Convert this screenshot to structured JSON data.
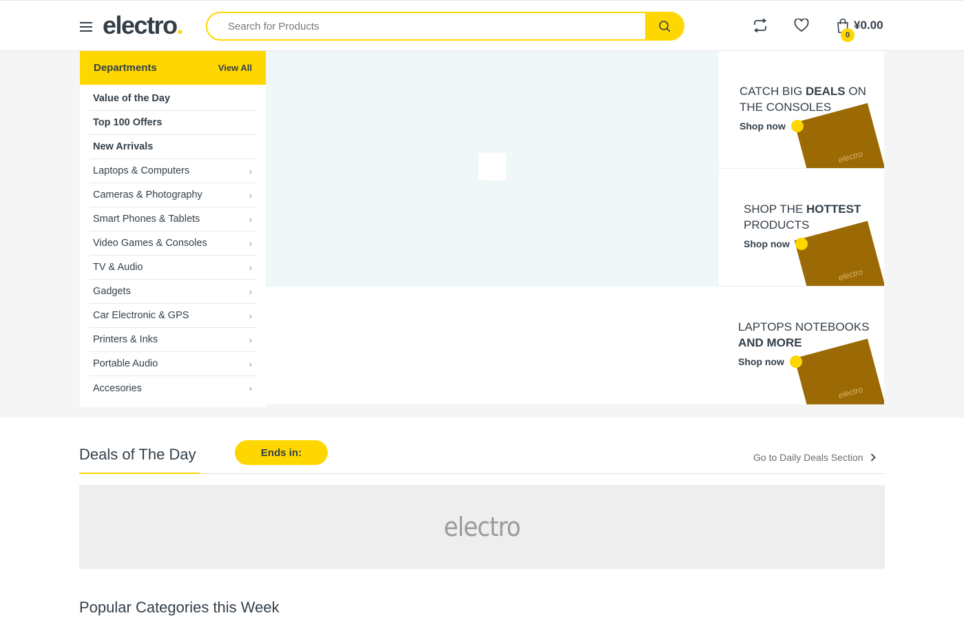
{
  "header": {
    "logo_text": "electro",
    "logo_dot": ".",
    "search_placeholder": "Search for Products",
    "cart_count": "0",
    "cart_total": "¥0.00",
    "accent_color": "#fed700"
  },
  "departments": {
    "title": "Departments",
    "view_all": "View All",
    "items": [
      {
        "label": "Value of the Day",
        "bold": true
      },
      {
        "label": "Top 100 Offers",
        "bold": true
      },
      {
        "label": "New Arrivals",
        "bold": true
      },
      {
        "label": "Laptops & Computers",
        "bold": false
      },
      {
        "label": "Cameras & Photography",
        "bold": false
      },
      {
        "label": "Smart Phones & Tablets",
        "bold": false
      },
      {
        "label": "Video Games & Consoles",
        "bold": false
      },
      {
        "label": "TV & Audio",
        "bold": false
      },
      {
        "label": "Gadgets",
        "bold": false
      },
      {
        "label": "Car Electronic & GPS",
        "bold": false
      },
      {
        "label": "Printers & Inks",
        "bold": false
      },
      {
        "label": "Portable Audio",
        "bold": false
      },
      {
        "label": "Accesories",
        "bold": false
      }
    ]
  },
  "banners": [
    {
      "pre": "Catch Big ",
      "bold": "Deals",
      "post": " on the Consoles",
      "cta": "Shop now",
      "image_label": "electro"
    },
    {
      "pre": "Shop the ",
      "bold": "Hottest",
      "post": " Products",
      "cta": "Shop now",
      "image_label": "electro"
    },
    {
      "pre": "Laptops Notebooks ",
      "bold": "And More",
      "post": "",
      "cta": "Shop now",
      "image_label": "electro"
    }
  ],
  "deals": {
    "title": "Deals of The Day",
    "ends_in": "Ends in:",
    "daily_link": "Go to Daily Deals Section",
    "banner_logo": "electro"
  },
  "popular": {
    "title": "Popular Categories this Week"
  }
}
